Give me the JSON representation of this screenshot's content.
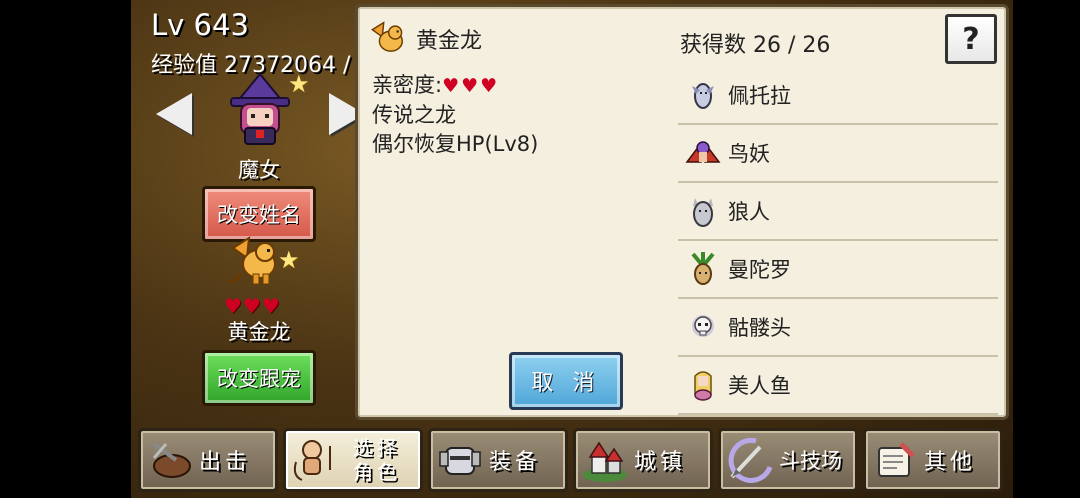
{
  "player": {
    "level": "Lv 643",
    "exp": "经验值 27372064 /"
  },
  "character": {
    "name": "魔女",
    "rename_label": "改变姓名"
  },
  "pet": {
    "name": "黄金龙",
    "hearts": "♥♥♥",
    "change_label": "改变跟宠"
  },
  "dialog": {
    "pet_name": "黄金龙",
    "intimacy_label": "亲密度:",
    "intimacy_hearts": "♥♥♥",
    "desc1": "传说之龙",
    "desc2": "偶尔恢复HP(Lv8)",
    "cancel_label": "取 消",
    "count": "获得数 26 / 26",
    "help": "?",
    "list": [
      {
        "name": "佩托拉",
        "icon": "petora-icon"
      },
      {
        "name": "鸟妖",
        "icon": "harpy-icon"
      },
      {
        "name": "狼人",
        "icon": "werewolf-icon"
      },
      {
        "name": "曼陀罗",
        "icon": "mandrake-icon"
      },
      {
        "name": "骷髅头",
        "icon": "skull-icon"
      },
      {
        "name": "美人鱼",
        "icon": "mermaid-icon"
      }
    ]
  },
  "nav": [
    {
      "label": "出击",
      "icon": "sortie-icon"
    },
    {
      "label": "选择角色",
      "line1": "选择",
      "line2": "角色",
      "icon": "select-character-icon"
    },
    {
      "label": "装备",
      "icon": "equipment-icon"
    },
    {
      "label": "城镇",
      "icon": "town-icon"
    },
    {
      "label": "斗技场",
      "icon": "arena-icon"
    },
    {
      "label": "其他",
      "icon": "other-icon"
    }
  ]
}
